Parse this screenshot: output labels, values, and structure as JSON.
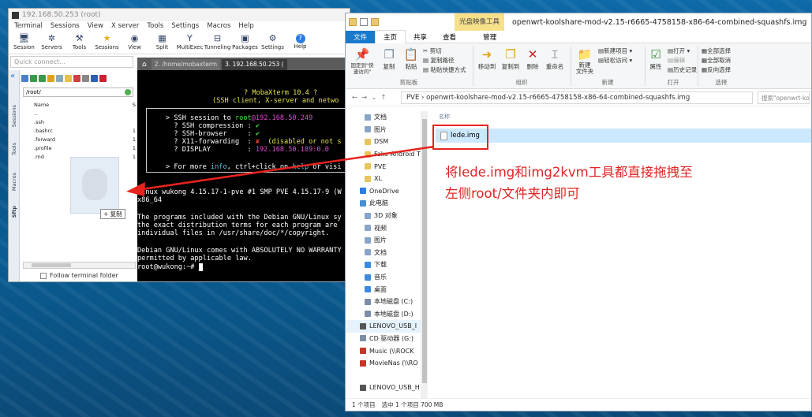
{
  "moba": {
    "title": "192.168.50.253 (root)",
    "menu": [
      "Terminal",
      "Sessions",
      "View",
      "X server",
      "Tools",
      "Settings",
      "Macros",
      "Help"
    ],
    "toolbar": [
      {
        "label": "Session",
        "icon": "session-icon"
      },
      {
        "label": "Servers",
        "icon": "servers-icon"
      },
      {
        "label": "Tools",
        "icon": "tools-icon"
      },
      {
        "label": "Sessions",
        "icon": "star-icon"
      },
      {
        "label": "View",
        "icon": "view-icon"
      },
      {
        "label": "Split",
        "icon": "split-icon"
      },
      {
        "label": "MultiExec",
        "icon": "multiexec-icon"
      },
      {
        "label": "Tunneling",
        "icon": "tunneling-icon"
      },
      {
        "label": "Packages",
        "icon": "packages-icon"
      },
      {
        "label": "Settings",
        "icon": "settings-icon"
      },
      {
        "label": "Help",
        "icon": "help-icon"
      }
    ],
    "quick_connect_placeholder": "Quick connect...",
    "tabs": [
      "2. /home/mobaxterm",
      "3. 192.168.50.253 ("
    ],
    "side_tabs": [
      "Sessions",
      "Tools",
      "Macros",
      "Sftp"
    ],
    "path": "/root/",
    "file_header": "Name",
    "file_header_right": "S",
    "files": [
      {
        "name": "..",
        "size": ""
      },
      {
        "name": ".ssh",
        "size": ""
      },
      {
        "name": ".bashrc",
        "size": "1"
      },
      {
        "name": ".forward",
        "size": "1"
      },
      {
        "name": ".profile",
        "size": "1"
      },
      {
        "name": ".rnd",
        "size": "1"
      }
    ],
    "copy_badge": "+ 复制",
    "follow_label": "Follow terminal folder"
  },
  "terminal": {
    "banner1": "? MobaXterm 10.4 ?",
    "banner2": "(SSH client, X-server and netwo",
    "ssh_session_prefix": "> SSH session to ",
    "ssh_user": "root",
    "ssh_host": "@192.168.50.249",
    "compression": "  ? SSH compression : ",
    "browser": "  ? SSH-browser     : ",
    "x11": "  ? X11-forwarding  : ",
    "x11_note": "  (disabled or not s",
    "display": "  ? DISPLAY         : ",
    "display_val": "192.168.50.189:0.0",
    "check": "✔",
    "cross": "✘",
    "more_prefix": "> For more ",
    "more_info": "info",
    "more_mid": ", ctrl+click on ",
    "more_help": "help",
    "more_end": " or visi",
    "linux_line": "Linux wukong 4.15.17-1-pve #1 SMP PVE 4.15.17-9 (W",
    "arch": "x86_64",
    "p1": "The programs included with the Debian GNU/Linux sy",
    "p2": "the exact distribution terms for each program are",
    "p3": "individual files in /usr/share/doc/*/copyright.",
    "p4": "Debian GNU/Linux comes with ABSOLUTELY NO WARRANTY",
    "p5": "permitted by applicable law.",
    "prompt": "root@wukong:~# "
  },
  "explorer": {
    "context_tab": "光盘映像工具",
    "title": "openwrt-koolshare-mod-v2.15-r6665-4758158-x86-64-combined-squashfs.img",
    "ribbon_tabs": [
      "文件",
      "主页",
      "共享",
      "查看",
      "管理"
    ],
    "groups": [
      "剪贴板",
      "组织",
      "新建",
      "打开",
      "选择"
    ],
    "clipboard": {
      "pin": "固定到\"快速访问\"",
      "copy": "复制",
      "paste": "粘贴",
      "cut": "剪切",
      "copy_path": "复制路径",
      "paste_shortcut": "粘贴快捷方式"
    },
    "organize": {
      "move": "移动到",
      "copyto": "复制到",
      "delete": "删除",
      "rename": "重命名"
    },
    "new": {
      "folder": "新建\n文件夹",
      "new_item": "新建项目 ▾",
      "easy_access": "轻松访问 ▾"
    },
    "open": {
      "props": "属性",
      "open": "打开 ▾",
      "edit": "编辑",
      "history": "历史记录"
    },
    "select": {
      "all": "全部选择",
      "none": "全部取消",
      "invert": "反向选择"
    },
    "breadcrumb": "PVE  ›  openwrt-koolshare-mod-v2.15-r6665-4758158-x86-64-combined-squashfs.img",
    "search_placeholder": "搜索\"openwrt-koo",
    "tree": [
      {
        "label": "文档",
        "color": "#8aa4c8"
      },
      {
        "label": "图片",
        "color": "#8aa4c8"
      },
      {
        "label": "DSM",
        "color": "#e8c55a"
      },
      {
        "label": "Fake Android T",
        "color": "#e8c55a"
      },
      {
        "label": "PVE",
        "color": "#e8c55a"
      },
      {
        "label": "XL",
        "color": "#e8c55a"
      },
      {
        "label": "OneDrive",
        "color": "#2d7de0"
      },
      {
        "label": "此电脑",
        "color": "#4a8fd4"
      },
      {
        "label": "3D 对象",
        "color": "#8aa4c8"
      },
      {
        "label": "视频",
        "color": "#8aa4c8"
      },
      {
        "label": "图片",
        "color": "#8aa4c8"
      },
      {
        "label": "文档",
        "color": "#8aa4c8"
      },
      {
        "label": "下载",
        "color": "#3a8be0"
      },
      {
        "label": "音乐",
        "color": "#3a8be0"
      },
      {
        "label": "桌面",
        "color": "#3a8be0"
      },
      {
        "label": "本地磁盘 (C:)",
        "color": "#7c8ea6"
      },
      {
        "label": "本地磁盘 (D:)",
        "color": "#7c8ea6"
      },
      {
        "label": "LENOVO_USB_I",
        "color": "#555555"
      },
      {
        "label": "CD 驱动器 (G:)",
        "color": "#7c8ea6"
      },
      {
        "label": "Music (\\\\ROCK",
        "color": "#c0392b"
      },
      {
        "label": "MovieNas (\\\\RO",
        "color": "#c0392b"
      },
      {
        "label": "",
        "color": "#ffffff"
      },
      {
        "label": "LENOVO_USB_H",
        "color": "#555555"
      }
    ],
    "column_name": "名称",
    "file": "lede.img",
    "note_line1": "将lede.img和img2kvm工具都直接拖拽至",
    "note_line2": "左侧root/文件夹内即可",
    "status_items": "1 个项目",
    "status_selected": "选中 1 个项目  700 MB",
    "annotation_color": "#e8231e"
  }
}
